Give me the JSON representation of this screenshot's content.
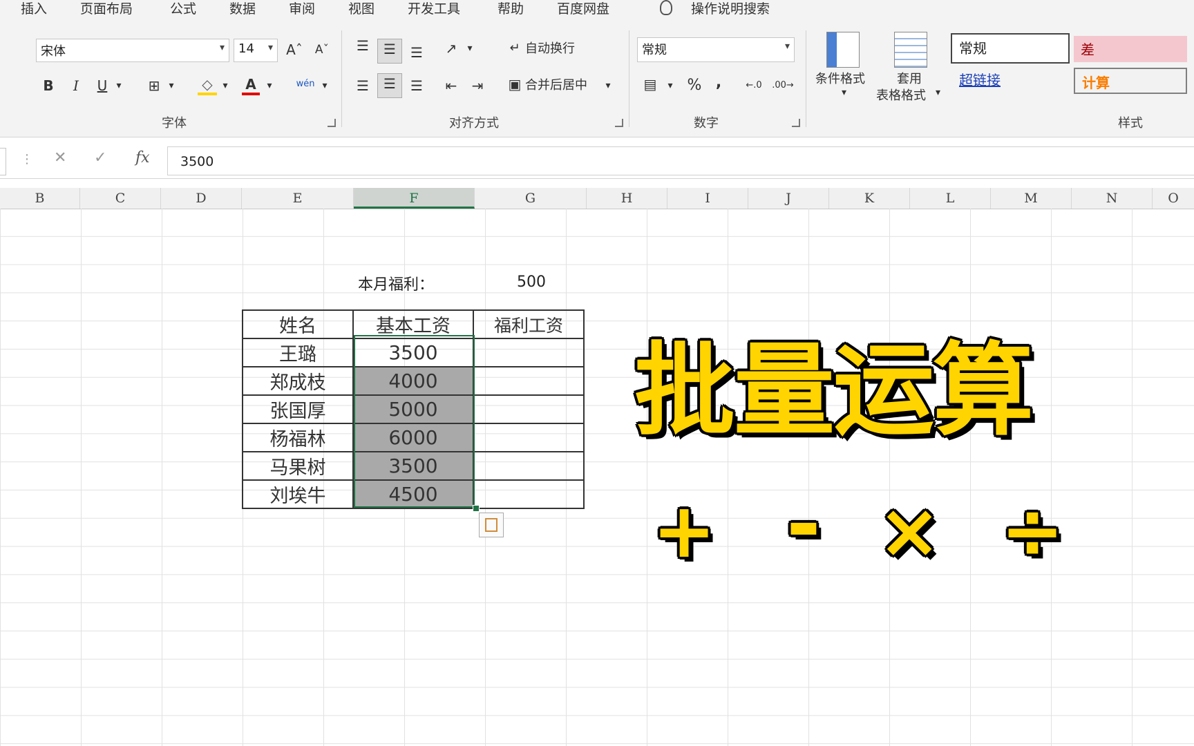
{
  "menu": {
    "tabs": [
      "插入",
      "页面布局",
      "公式",
      "数据",
      "审阅",
      "视图",
      "开发工具",
      "帮助",
      "百度网盘"
    ],
    "tell_me": "操作说明搜索"
  },
  "ribbon": {
    "font": {
      "name": "宋体",
      "size": "14",
      "grow": "Aˆ",
      "shrink": "Aˇ",
      "bold": "B",
      "italic": "I",
      "underline": "U",
      "font_color": "A",
      "phonetic": "wén",
      "label": "字体"
    },
    "alignment": {
      "wrap_text": "自动换行",
      "merge_center": "合并后居中",
      "label": "对齐方式"
    },
    "number": {
      "format": "常规",
      "percent": "%",
      "comma": ",",
      "label": "数字"
    },
    "styles": {
      "conditional_format": "条件格式",
      "table_format_line1": "套用",
      "table_format_line2": "表格格式",
      "normal": "常规",
      "bad": "差",
      "hyperlink": "超链接",
      "calculation": "计算",
      "label": "样式"
    }
  },
  "formula_bar": {
    "cancel": "✕",
    "enter": "✓",
    "fx": "fx",
    "value": "3500"
  },
  "columns": [
    "B",
    "C",
    "D",
    "E",
    "F",
    "G",
    "H",
    "I",
    "J",
    "K",
    "L",
    "M",
    "N",
    "O"
  ],
  "sheet": {
    "welfare_label": "本月福利：",
    "welfare_value": "500",
    "table": {
      "headers": [
        "姓名",
        "基本工资",
        "福利工资"
      ],
      "rows": [
        {
          "name": "王璐",
          "base": "3500",
          "welfare": ""
        },
        {
          "name": "郑成枝",
          "base": "4000",
          "welfare": ""
        },
        {
          "name": "张国厚",
          "base": "5000",
          "welfare": ""
        },
        {
          "name": "杨福林",
          "base": "6000",
          "welfare": ""
        },
        {
          "name": "马果树",
          "base": "3500",
          "welfare": ""
        },
        {
          "name": "刘埃牛",
          "base": "4500",
          "welfare": ""
        }
      ]
    }
  },
  "overlay": {
    "title": "批量运算",
    "ops": [
      "+",
      "-",
      "×",
      "÷"
    ]
  },
  "colors": {
    "excel_green": "#217346",
    "overlay_yellow": "#ffd400",
    "bad_style_bg": "#f4c7ce",
    "bad_style_text": "#9c0006",
    "calc_style_text": "#fa7d00"
  }
}
